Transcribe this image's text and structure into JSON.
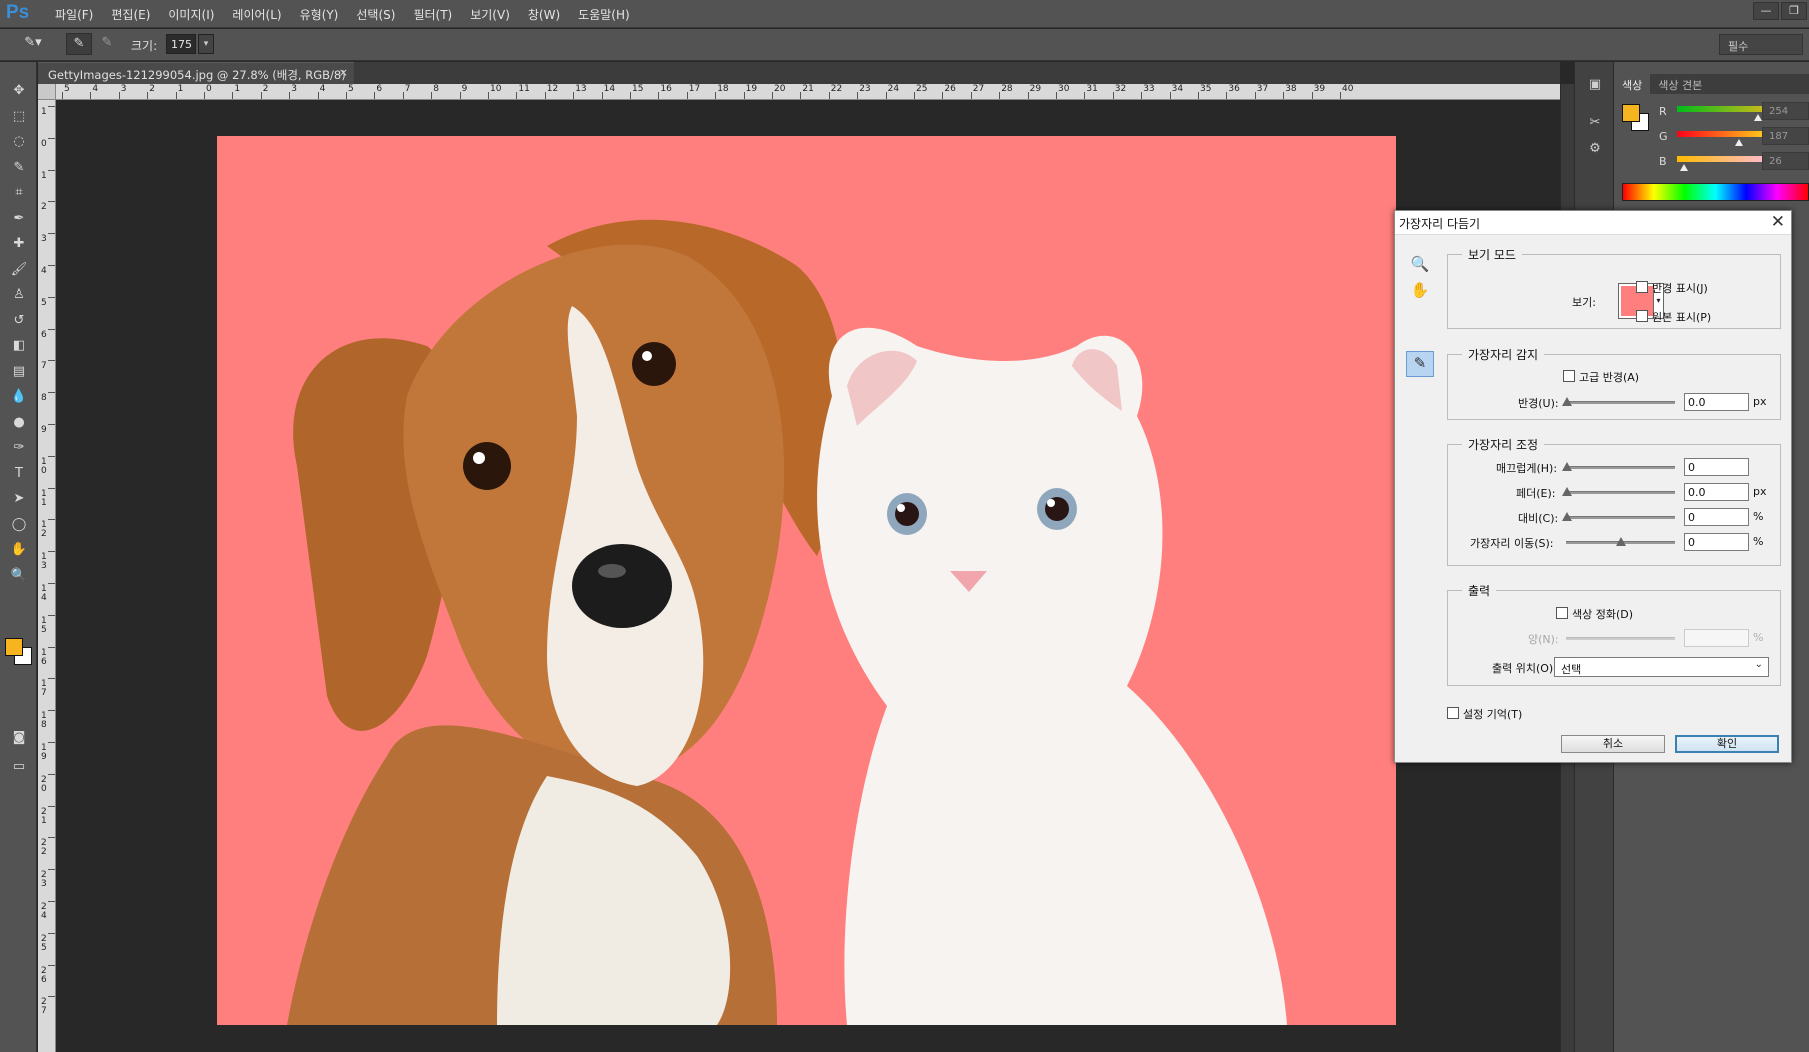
{
  "app": {
    "logo": "Ps"
  },
  "menu": [
    "파일(F)",
    "편집(E)",
    "이미지(I)",
    "레이어(L)",
    "유형(Y)",
    "선택(S)",
    "필터(T)",
    "보기(V)",
    "창(W)",
    "도움말(H)"
  ],
  "window_controls": {
    "minimize": "—",
    "restore": "❐"
  },
  "options_bar": {
    "size_label": "크기:",
    "size_value": "175",
    "workspace": "필수"
  },
  "document": {
    "tab_title": "GettyImages-121299054.jpg @ 27.8% (배경, RGB/8)",
    "close": "×"
  },
  "ruler": {
    "top_labels": [
      "5",
      "4",
      "3",
      "2",
      "1",
      "0",
      "1",
      "2",
      "3",
      "4",
      "5",
      "6",
      "7",
      "8",
      "9",
      "10",
      "11",
      "12",
      "13",
      "14",
      "15",
      "16",
      "17",
      "18",
      "19",
      "20",
      "21",
      "22",
      "23",
      "24",
      "25",
      "26",
      "27",
      "28",
      "29",
      "30",
      "31",
      "32",
      "33",
      "34",
      "35",
      "36",
      "37",
      "38",
      "39",
      "40"
    ],
    "left_labels": [
      "1",
      "0",
      "1",
      "2",
      "3",
      "4",
      "5",
      "6",
      "7",
      "8",
      "9",
      "10",
      "11",
      "12",
      "13",
      "14",
      "15",
      "16",
      "17",
      "18",
      "19",
      "20",
      "21",
      "22",
      "23",
      "24",
      "25",
      "26",
      "27"
    ]
  },
  "tools": [
    "move-icon",
    "marquee-icon",
    "lasso-icon",
    "quick-select-icon",
    "crop-icon",
    "eyedropper-icon",
    "healing-icon",
    "brush-icon",
    "stamp-icon",
    "history-brush-icon",
    "eraser-icon",
    "gradient-icon",
    "blur-icon",
    "dodge-icon",
    "pen-icon",
    "type-icon",
    "path-select-icon",
    "ellipse-icon",
    "hand-icon",
    "zoom-icon"
  ],
  "tool_glyphs": [
    "✥",
    "⬚",
    "◌",
    "✎",
    "⌗",
    "✒",
    "✚",
    "🖌",
    "♙",
    "↺",
    "◧",
    "▤",
    "💧",
    "●",
    "✑",
    "T",
    "➤",
    "◯",
    "✋",
    "🔍"
  ],
  "colors": {
    "foreground": "#f6b41e",
    "background": "#ffffff",
    "photo_bg": "#ff7f7e"
  },
  "color_panel": {
    "tabs": [
      "색상",
      "색상 견본"
    ],
    "channels": [
      {
        "name": "R",
        "value": "254"
      },
      {
        "name": "G",
        "value": "187"
      },
      {
        "name": "B",
        "value": "26"
      }
    ]
  },
  "dialog": {
    "title": "가장자리 다듬기",
    "close": "✕",
    "view_mode": {
      "title": "보기 모드",
      "view_label": "보기:",
      "show_radius": "반경 표시(J)",
      "show_original": "원본 표시(P)"
    },
    "edge_detection": {
      "title": "가장자리 감지",
      "smart_radius": "고급 반경(A)",
      "radius_label": "반경(U):",
      "radius_value": "0.0",
      "radius_unit": "px"
    },
    "adjust_edge": {
      "title": "가장자리 조정",
      "smooth_label": "매끄럽게(H):",
      "smooth_value": "0",
      "feather_label": "페더(E):",
      "feather_value": "0.0",
      "feather_unit": "px",
      "contrast_label": "대비(C):",
      "contrast_value": "0",
      "contrast_unit": "%",
      "shift_label": "가장자리 이동(S):",
      "shift_value": "0",
      "shift_unit": "%"
    },
    "output": {
      "title": "출력",
      "decontaminate": "색상 정화(D)",
      "amount_label": "양(N):",
      "amount_unit": "%",
      "output_to_label": "출력 위치(O):",
      "output_to_value": "선택"
    },
    "remember": "설정 기억(T)",
    "cancel": "취소",
    "ok": "확인"
  }
}
